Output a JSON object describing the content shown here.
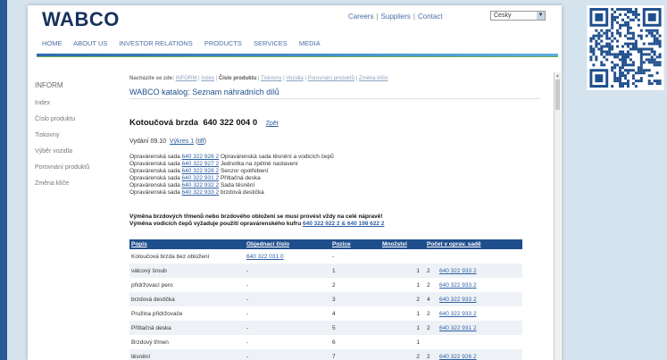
{
  "header": {
    "logo": "WABCO",
    "top_links": [
      "Careers",
      "Suppliers",
      "Contact"
    ],
    "language": "Česky"
  },
  "nav": [
    "HOME",
    "ABOUT US",
    "INVESTOR RELATIONS",
    "PRODUCTS",
    "SERVICES",
    "MEDIA"
  ],
  "sidebar": {
    "items": [
      "INFORM",
      "Index",
      "Číslo produktu",
      "Tiskovny",
      "Výběr vozidla",
      "Porovnání produktů",
      "Změna klíče"
    ]
  },
  "breadcrumb": {
    "label": "Nacházíte se zde:",
    "items": [
      "INFORM",
      "Index",
      "Číslo produktu",
      "Tiskovny",
      "Vozidla",
      "Porovnání produktů",
      "Změna klíče"
    ],
    "current_index": 2
  },
  "catalog_title": "WABCO katalog: Seznam náhradních dílů",
  "product": {
    "name": "Kotoučová brzda",
    "number": "640 322 004 0",
    "back": "Zpět"
  },
  "edition": {
    "label": "Vydání 09.10",
    "drawing": "Výkres 1",
    "format": "tiff"
  },
  "kits": [
    {
      "label": "Opravárenská sada",
      "number": "640 322 926 2",
      "desc": "Opravárenská sada těsnění a vodicích čepů"
    },
    {
      "label": "Opravárenská sada",
      "number": "640 322 927 2",
      "desc": "Jednotka na zpětné nastavení"
    },
    {
      "label": "Opravárenská sada",
      "number": "640 322 928 2",
      "desc": "Senzor opotřebení"
    },
    {
      "label": "Opravárenská sada",
      "number": "640 322 931 2",
      "desc": "Přítlačná deska"
    },
    {
      "label": "Opravárenská sada",
      "number": "640 322 932 2",
      "desc": "Sada těsnění"
    },
    {
      "label": "Opravárenská sada",
      "number": "640 322 933 2",
      "desc": "brzdová destička"
    }
  ],
  "notes": {
    "line1": "Výměna brzdových třmenů nebo brzdového obložení se musí provést vždy na celé nápravě!",
    "line2_prefix": "Výměna vodicích čepů vyžaduje použití opravárenského kufru",
    "line2_link": "640 322 922 2 & 640 198 622 2"
  },
  "table": {
    "headers": [
      "Popis",
      "Objednací číslo",
      "Pozice",
      "Množství",
      "Počet v oprav. sadě"
    ],
    "rows": [
      {
        "popis": "Kotoučová brzda bez obložení",
        "cislo": "640 322 031 0",
        "pozice": "-",
        "mnozstvi": "",
        "pocet": "",
        "sada": ""
      },
      {
        "popis": "válcový šroub",
        "cislo": "-",
        "pozice": "1",
        "mnozstvi": "1",
        "pocet": "2",
        "sada": "640 322 933 2"
      },
      {
        "popis": "přidržovací pero",
        "cislo": "-",
        "pozice": "2",
        "mnozstvi": "1",
        "pocet": "2",
        "sada": "640 322 933 2"
      },
      {
        "popis": "brzdová destička",
        "cislo": "-",
        "pozice": "3",
        "mnozstvi": "2",
        "pocet": "4",
        "sada": "640 322 933 2"
      },
      {
        "popis": "Pružina přidržovače",
        "cislo": "-",
        "pozice": "4",
        "mnozstvi": "1",
        "pocet": "2",
        "sada": "640 322 933 2"
      },
      {
        "popis": "Přítlačná deska",
        "cislo": "-",
        "pozice": "5",
        "mnozstvi": "1",
        "pocet": "2",
        "sada": "640 322 931 2"
      },
      {
        "popis": "Brzdový třmen",
        "cislo": "-",
        "pozice": "6",
        "mnozstvi": "1",
        "pocet": "",
        "sada": ""
      },
      {
        "popis": "těsnění",
        "cislo": "-",
        "pozice": "7",
        "mnozstvi": "2",
        "pocet": "2",
        "sada": "640 322 926 2"
      }
    ]
  },
  "colors": {
    "brand": "#16325c",
    "accent": "#1f4e8c",
    "link": "#2b5fa5"
  }
}
